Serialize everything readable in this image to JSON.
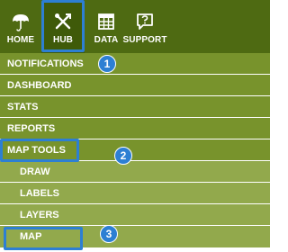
{
  "colors": {
    "topbar": "#4e6a12",
    "topbar_active": "#3f5a09",
    "menu_row": "#78932c",
    "submenu_row": "#92a94c",
    "highlight": "#2d7fd3"
  },
  "toolbar": {
    "buttons": [
      {
        "label": "HOME",
        "icon": "umbrella-icon"
      },
      {
        "label": "HUB",
        "icon": "tools-icon",
        "active": true
      },
      {
        "label": "DATA",
        "icon": "table-icon"
      },
      {
        "label": "SUPPORT",
        "icon": "help-chat-icon"
      }
    ]
  },
  "menu": {
    "items": [
      {
        "label": "NOTIFICATIONS"
      },
      {
        "label": "DASHBOARD"
      },
      {
        "label": "STATS"
      },
      {
        "label": "REPORTS"
      },
      {
        "label": "MAP TOOLS",
        "expanded": true
      },
      {
        "label": "DRAW",
        "sub": true
      },
      {
        "label": "LABELS",
        "sub": true
      },
      {
        "label": "LAYERS",
        "sub": true
      },
      {
        "label": "MAP",
        "sub": true
      }
    ]
  },
  "callouts": [
    "1",
    "2",
    "3"
  ]
}
